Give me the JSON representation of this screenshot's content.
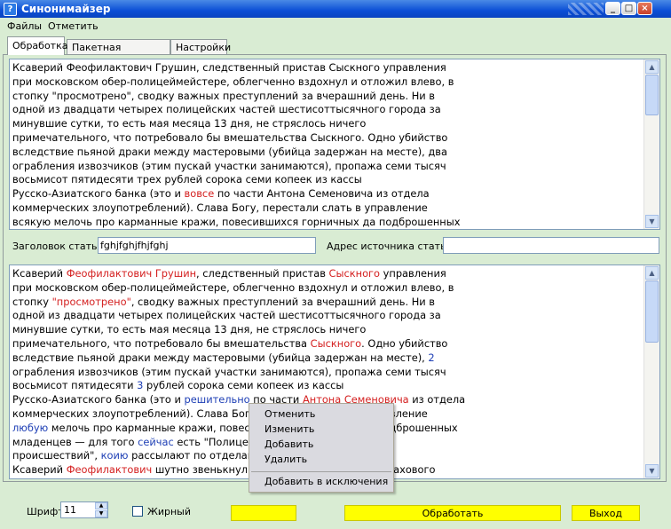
{
  "window": {
    "title": "Синонимайзер",
    "app_icon_glyph": "?"
  },
  "window_controls": {
    "minimize": "_",
    "maximize": "□",
    "close": "×"
  },
  "menu": {
    "items": [
      "Файлы",
      "Отметить"
    ]
  },
  "tabs": [
    "Обработка",
    "Пакетная обработка",
    "Настройки"
  ],
  "source_text": {
    "lines": [
      [
        {
          "t": "Ксаверий Феофилактович Грушин, следственный пристав Сыскного управления"
        }
      ],
      [
        {
          "t": "при московском обер-полицеймейстере, облегченно вздохнул и отложил влево, в"
        }
      ],
      [
        {
          "t": "стопку \"просмотрено\", сводку важных преступлений за вчерашний день. Ни в"
        }
      ],
      [
        {
          "t": "одной из двадцати четырех полицейских частей шестисоттысячного города за"
        }
      ],
      [
        {
          "t": "минувшие сутки, то есть мая месяца 13 дня, не стряслось ничего"
        }
      ],
      [
        {
          "t": "примечательного, что потребовало бы вмешательства Сыскного. Одно убийство"
        }
      ],
      [
        {
          "t": "вследствие пьяной драки между мастеровыми (убийца задержан на месте), два"
        }
      ],
      [
        {
          "t": "ограбления извозчиков (этим пускай участки занимаются), пропажа семи тысяч"
        }
      ],
      [
        {
          "t": "восьмисот пятидесяти трех рублей сорока семи копеек из кассы"
        }
      ],
      [
        {
          "t": "Русско-Азиатского банка (это и "
        },
        {
          "t": "вовсе",
          "c": "red"
        },
        {
          "t": " по части Антона Семеновича из отдела"
        }
      ],
      [
        {
          "t": "коммерческих злоупотреблений). Слава Богу, перестали слать в управление"
        }
      ],
      [
        {
          "t": "всякую мелочь про карманные кражи, повесившихся горничных да подброшенных"
        }
      ]
    ]
  },
  "fields": {
    "article_title_label": "Заголовок статьи",
    "article_title_value": "fghjfghjfhjfghj",
    "source_address_label": "Адрес источника статьи",
    "source_address_value": ""
  },
  "result_text": {
    "lines": [
      [
        {
          "t": "Ксаверий "
        },
        {
          "t": "Феофилактович Грушин",
          "c": "red"
        },
        {
          "t": ", следственный пристав "
        },
        {
          "t": "Сыскного",
          "c": "red"
        },
        {
          "t": " управления"
        }
      ],
      [
        {
          "t": "при московском обер-полицеймейстере, облегченно вздохнул и отложил влево, в"
        }
      ],
      [
        {
          "t": "стопку "
        },
        {
          "t": "\"просмотрено\"",
          "c": "red"
        },
        {
          "t": ", сводку важных преступлений за вчерашний день. Ни в"
        }
      ],
      [
        {
          "t": "одной из двадцати четырех полицейских частей шестисоттысячного города за"
        }
      ],
      [
        {
          "t": "минувшие сутки, то есть мая месяца 13 дня, не стряслось ничего"
        }
      ],
      [
        {
          "t": "примечательного, что потребовало бы вмешательства "
        },
        {
          "t": "Сыскного",
          "c": "red"
        },
        {
          "t": ". Одно убийство"
        }
      ],
      [
        {
          "t": "вследствие пьяной драки между мастеровыми (убийца задержан на месте), "
        },
        {
          "t": "2",
          "c": "blue"
        }
      ],
      [
        {
          "t": "ограбления извозчиков (этим пускай участки занимаются), пропажа семи тысяч"
        }
      ],
      [
        {
          "t": "восьмисот пятидесяти "
        },
        {
          "t": "3",
          "c": "blue"
        },
        {
          "t": " рублей сорока семи копеек из кассы"
        }
      ],
      [
        {
          "t": "Русско-Азиатского банка (это и "
        },
        {
          "t": "решительно",
          "c": "blue"
        },
        {
          "t": " по части "
        },
        {
          "t": "Антона Семеновича",
          "c": "red"
        },
        {
          "t": " из отдела"
        }
      ],
      [
        {
          "t": "коммерческих злоупотреблений). Слава Богу, перестали слать в управление"
        }
      ],
      [
        {
          "t": "любую",
          "c": "blue"
        },
        {
          "t": " мелочь про карманные кражи, повесившихся горничных да подброшенных"
        }
      ],
      [
        {
          "t": "младенцев — для того "
        },
        {
          "t": "сейчас",
          "c": "blue"
        },
        {
          "t": " есть \"Полицейский вестник\" и хроника"
        }
      ],
      [
        {
          "t": "происшествий\", "
        },
        {
          "t": "коию",
          "c": "blue"
        },
        {
          "t": " рассылают по отделам"
        }
      ],
      [
        {
          "t": "Ксаверий "
        },
        {
          "t": "Феофилактович",
          "c": "red"
        },
        {
          "t": " шутно звенькнул ложечкой в стакане чая, пахового"
        }
      ]
    ]
  },
  "context_menu": {
    "items": [
      "Отменить",
      "Изменить",
      "Добавить",
      "Удалить"
    ],
    "extra_item": "Добавить в исключения"
  },
  "bottom": {
    "font_label": "Шрифт",
    "font_size": "11",
    "bold_label": "Жирный",
    "bold_checked": false,
    "blank_button_label": "",
    "process_button": "Обработать",
    "exit_button": "Выход"
  },
  "colors": {
    "highlight_red": "#d42020",
    "highlight_blue": "#1e3fb5",
    "accent_yellow": "#ffff00",
    "background": "#d9ecd3"
  }
}
